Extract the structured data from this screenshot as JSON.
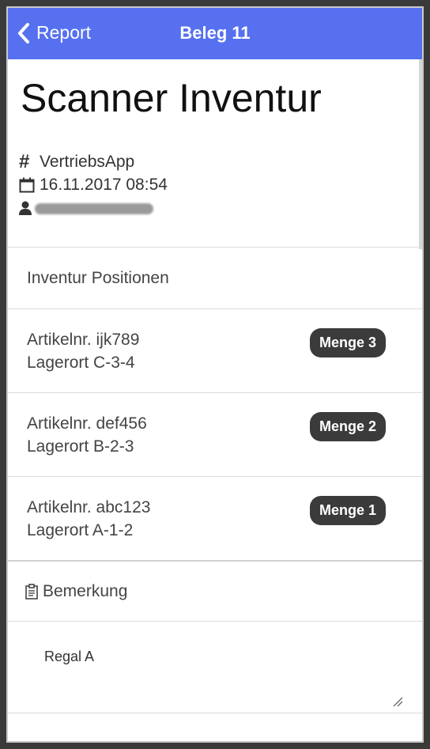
{
  "navbar": {
    "back_label": "Report",
    "title": "Beleg 11"
  },
  "header": {
    "title": "Scanner Inventur",
    "app_name": "VertriebsApp",
    "datetime": "16.11.2017 08:54"
  },
  "positions": {
    "heading": "Inventur Positionen",
    "items": [
      {
        "article": "Artikelnr. ijk789",
        "location": "Lagerort C-3-4",
        "quantity": "Menge 3"
      },
      {
        "article": "Artikelnr. def456",
        "location": "Lagerort B-2-3",
        "quantity": "Menge 2"
      },
      {
        "article": "Artikelnr. abc123",
        "location": "Lagerort A-1-2",
        "quantity": "Menge 1"
      }
    ]
  },
  "remark": {
    "heading": "Bemerkung",
    "value": "Regal A"
  },
  "colors": {
    "navbar": "#5670f0",
    "badge": "#3b3b3b"
  }
}
